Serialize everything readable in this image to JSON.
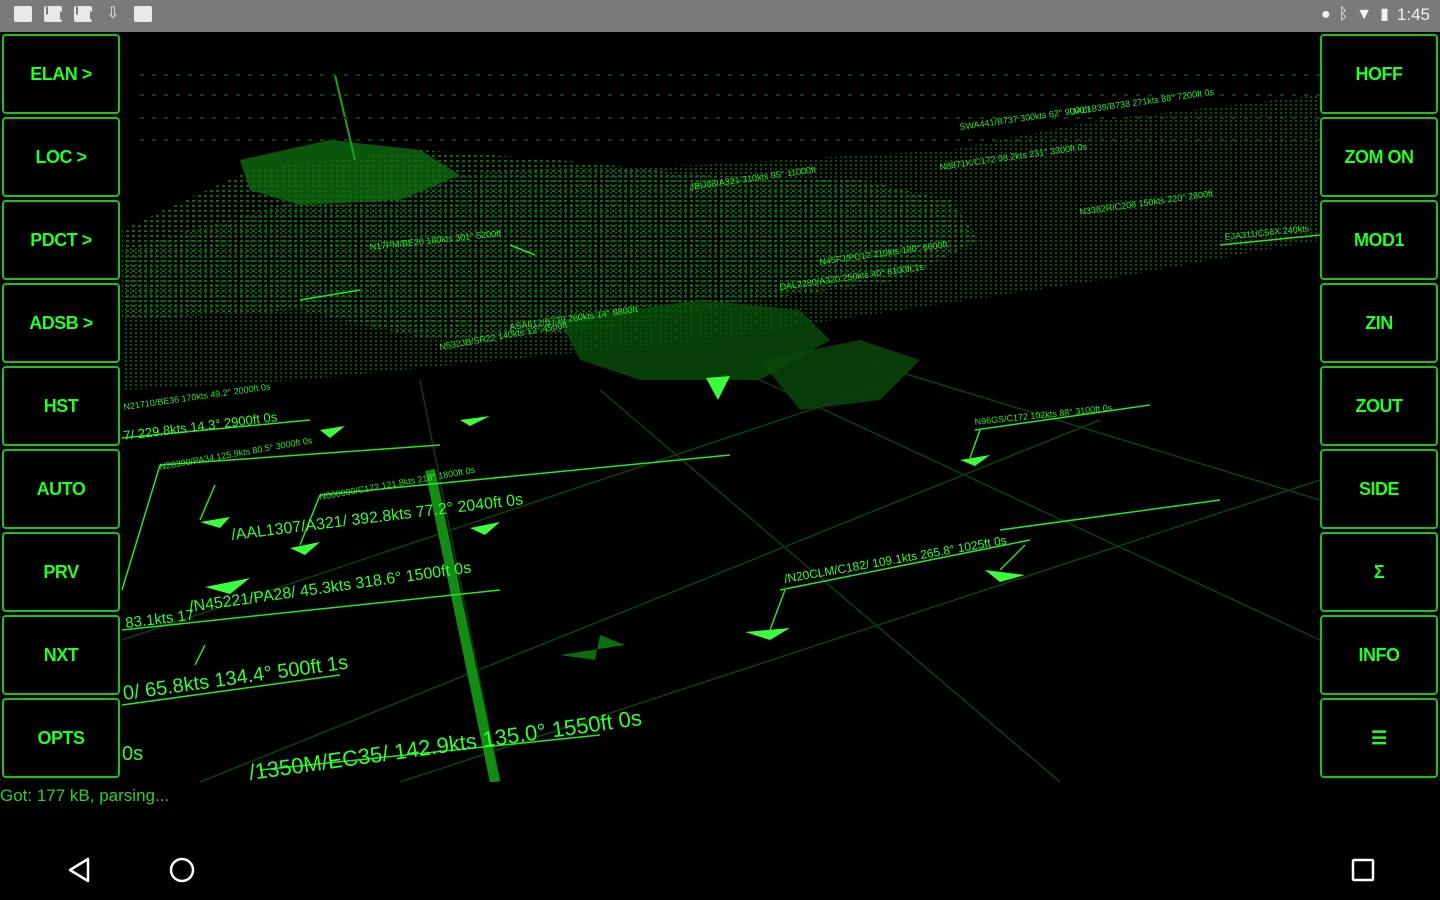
{
  "status_bar": {
    "time": "1:45",
    "left_icons": [
      "image-icon",
      "mail-icon",
      "mail-icon",
      "download-icon",
      "app-icon"
    ],
    "right_icons": [
      "location-icon",
      "bluetooth-icon",
      "wifi-icon",
      "battery-icon"
    ]
  },
  "left_buttons": [
    {
      "label": "ELAN >"
    },
    {
      "label": "LOC >"
    },
    {
      "label": "PDCT >"
    },
    {
      "label": "ADSB >"
    },
    {
      "label": "HST"
    },
    {
      "label": "AUTO"
    },
    {
      "label": "PRV"
    },
    {
      "label": "NXT"
    },
    {
      "label": "OPTS"
    }
  ],
  "right_buttons": [
    {
      "label": "HOFF"
    },
    {
      "label": "ZOM ON"
    },
    {
      "label": "MOD1"
    },
    {
      "label": "ZIN"
    },
    {
      "label": "ZOUT"
    },
    {
      "label": "SIDE"
    },
    {
      "label": "Σ"
    },
    {
      "label": "INFO"
    },
    {
      "label": "☰"
    }
  ],
  "aircraft_labels": [
    "/AAL1307/A321/ 392.8kts 77.2° 2040ft 0s",
    "/N45221/PA28/ 45.3kts 318.6° 1500ft 0s",
    "83.1kts 17",
    "0/ 65.8kts 134.4° 500ft 1s",
    "/1350M/EC35/ 142.9kts 135.0° 1550ft 0s",
    "/N20CLM/C182/ 109.1kts 265.8° 1025ft 0s",
    "7/ 229.8kts 14.3° 2900ft 0s",
    "0s"
  ],
  "status_message": "Got: 177 kB, parsing...",
  "nav": {
    "back": "back-icon",
    "home": "home-icon",
    "recents": "recents-icon"
  },
  "colors": {
    "accent": "#23ff23",
    "border": "#19c419",
    "background": "#000000",
    "status_bar": "#7a7a7a"
  }
}
